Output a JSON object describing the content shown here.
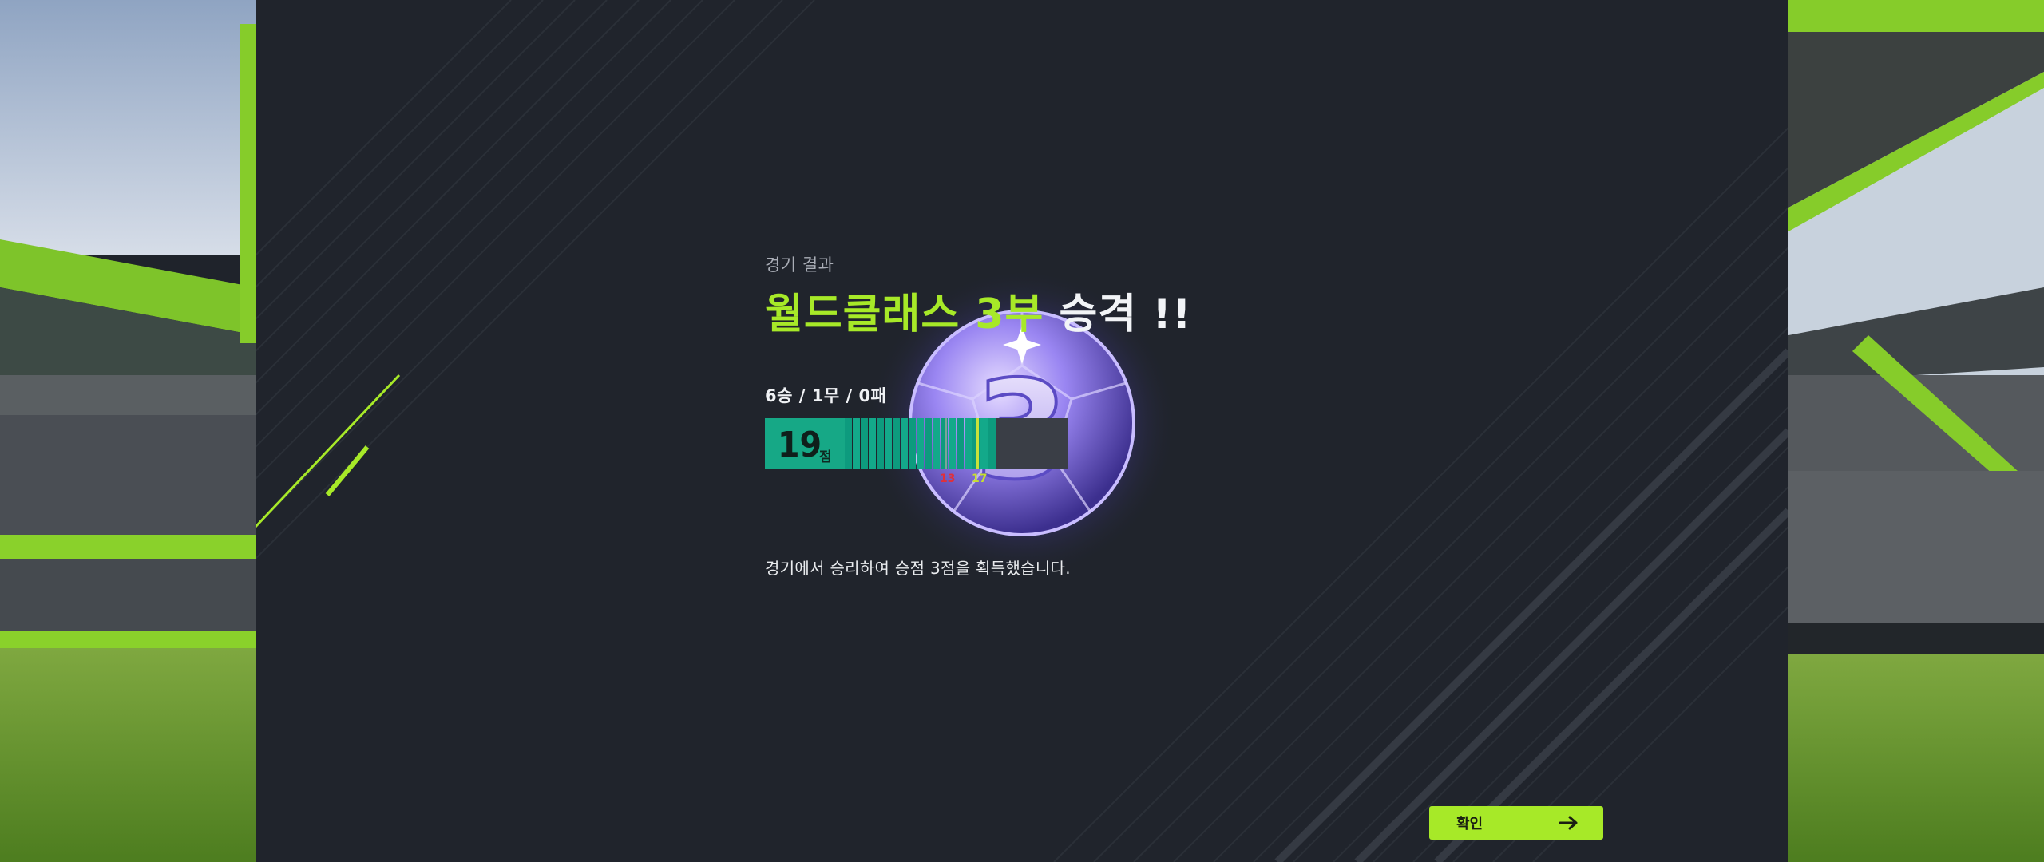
{
  "result": {
    "subtitle": "경기 결과",
    "headline_accent": "월드클래스 3부",
    "headline_rest": "승격 !!",
    "record": "6승 / 1무 / 0패",
    "score": "19",
    "score_unit": "점",
    "marker_low": "13",
    "marker_high": "17",
    "description": "경기에서 승리하여 승점 3점을 획득했습니다."
  },
  "progress": {
    "current_points": 19,
    "total_points": 28,
    "low_threshold": 13,
    "high_threshold": 17
  },
  "emblem": {
    "icon": "division-3-ball-emblem",
    "label": "3"
  },
  "button": {
    "confirm_label": "확인",
    "icon": "arrow-right-icon"
  },
  "colors": {
    "accent": "#a7e928",
    "score_fill": "#16a886",
    "panel": "#20242c",
    "marker_low": "#e0303a",
    "marker_high": "#c8e02e"
  }
}
